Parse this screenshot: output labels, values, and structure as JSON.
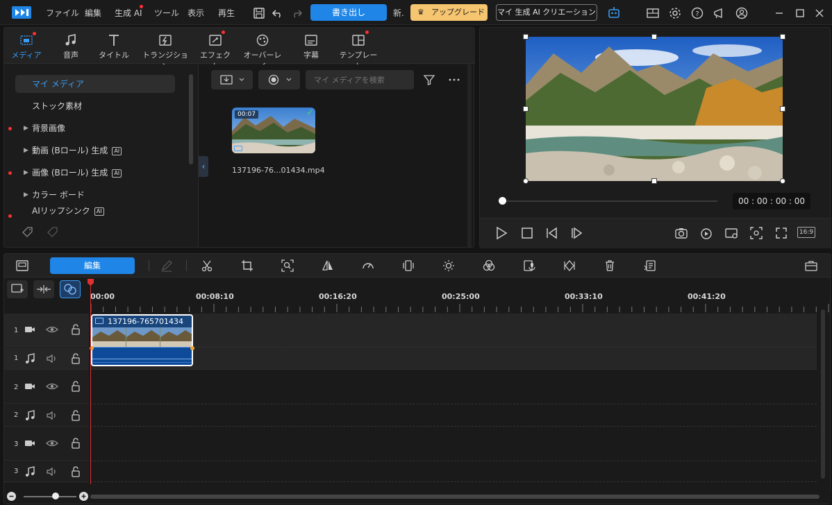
{
  "menu": [
    "ファイル",
    "編集",
    "生成 AI",
    "ツール",
    "表示",
    "再生"
  ],
  "topbar": {
    "new_label": "新.",
    "export_label": "書き出し",
    "upgrade_label": "アップグレード",
    "creation_label": "マイ 生成 AI クリエーション"
  },
  "media_tabs": [
    "メディア",
    "音声",
    "タイトル",
    "トランジション",
    "エフェクト",
    "オーバーレイ",
    "字幕",
    "テンプレート"
  ],
  "left_nav": [
    {
      "label": "マイ メディア",
      "selected": true
    },
    {
      "label": "ストック素材"
    },
    {
      "label": "背景画像",
      "arrow": true,
      "dot": true
    },
    {
      "label": "動画 (Bロール) 生成",
      "arrow": true,
      "ai": true
    },
    {
      "label": "画像 (Bロール) 生成",
      "arrow": true,
      "ai": true,
      "dot": true
    },
    {
      "label": "カラー ボード",
      "arrow": true
    },
    {
      "label": "AIリップシンク",
      "ai": true,
      "dot": true
    }
  ],
  "media": {
    "search_placeholder": "マイ メディアを検索",
    "ai_badge": "AI",
    "collapse_glyph": "‹",
    "clip": {
      "duration": "00:07",
      "filename": "137196-76...01434.mp4"
    }
  },
  "preview": {
    "timecode": "00 : 00 : 00 : 00",
    "aspect": "16:9"
  },
  "timeline": {
    "edit_label": "編集",
    "ruler": [
      "00:00",
      "00:08:10",
      "00:16:20",
      "00:25:00",
      "00:33:10",
      "00:41:20"
    ],
    "tracks": [
      {
        "num": "1",
        "type": "video"
      },
      {
        "num": "1",
        "type": "audio"
      },
      {
        "num": "2",
        "type": "video"
      },
      {
        "num": "2",
        "type": "audio"
      },
      {
        "num": "3",
        "type": "video"
      },
      {
        "num": "3",
        "type": "audio"
      }
    ],
    "clip_name": "137196-765701434"
  },
  "colors": {
    "accent": "#1f86e8",
    "upgrade": "#f6c56f",
    "playhead": "#e03030"
  }
}
